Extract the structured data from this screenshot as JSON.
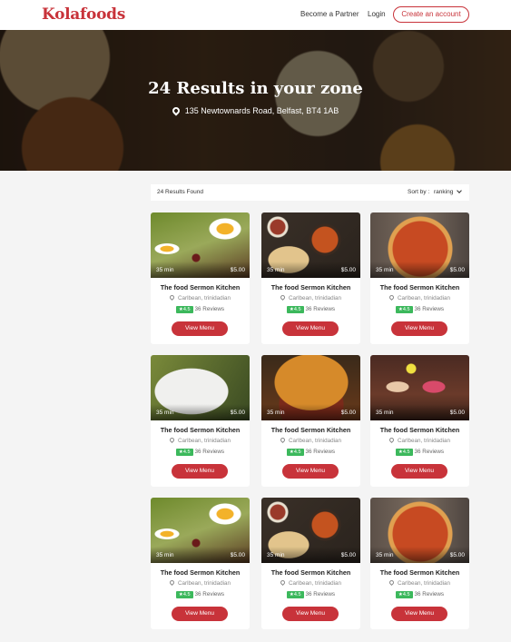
{
  "header": {
    "logo": "Kolafoods",
    "nav": {
      "partner": "Become a Partner",
      "login": "Login"
    },
    "cta": "Create an account"
  },
  "hero": {
    "title": "24 Results in your zone",
    "address": "135 Newtownards Road, Belfast, BT4 1AB"
  },
  "results": {
    "count": "24 Results Found",
    "sort_label": "Sort by :",
    "sort_value": "ranking"
  },
  "cards": [
    {
      "time": "35 min",
      "price": "$5.00",
      "name": "The food Sermon Kitchen",
      "location": "Carlbean, trinidadian",
      "rating": "4.5",
      "reviews": "36 Reviews",
      "button": "View Menu"
    },
    {
      "time": "35 min",
      "price": "$5.00",
      "name": "The food Sermon Kitchen",
      "location": "Carlbean, trinidadian",
      "rating": "4.5",
      "reviews": "36 Reviews",
      "button": "View Menu"
    },
    {
      "time": "35 min",
      "price": "$5.00",
      "name": "The food Sermon Kitchen",
      "location": "Carlbean, trinidadian",
      "rating": "4.5",
      "reviews": "36 Reviews",
      "button": "View Menu"
    },
    {
      "time": "35 min",
      "price": "$5.00",
      "name": "The food Sermon Kitchen",
      "location": "Carlbean, trinidadian",
      "rating": "4.5",
      "reviews": "36 Reviews",
      "button": "View Menu"
    },
    {
      "time": "35 min",
      "price": "$5.00",
      "name": "The food Sermon Kitchen",
      "location": "Carlbean, trinidadian",
      "rating": "4.5",
      "reviews": "36 Reviews",
      "button": "View Menu"
    },
    {
      "time": "35 min",
      "price": "$5.00",
      "name": "The food Sermon Kitchen",
      "location": "Carlbean, trinidadian",
      "rating": "4.5",
      "reviews": "36 Reviews",
      "button": "View Menu"
    },
    {
      "time": "35 min",
      "price": "$5.00",
      "name": "The food Sermon Kitchen",
      "location": "Carlbean, trinidadian",
      "rating": "4.5",
      "reviews": "36 Reviews",
      "button": "View Menu"
    },
    {
      "time": "35 min",
      "price": "$5.00",
      "name": "The food Sermon Kitchen",
      "location": "Carlbean, trinidadian",
      "rating": "4.5",
      "reviews": "36 Reviews",
      "button": "View Menu"
    },
    {
      "time": "35 min",
      "price": "$5.00",
      "name": "The food Sermon Kitchen",
      "location": "Carlbean, trinidadian",
      "rating": "4.5",
      "reviews": "36 Reviews",
      "button": "View Menu"
    }
  ],
  "colors": {
    "brand": "#c8333a",
    "rating": "#3cb85c"
  },
  "icons": {
    "location": "map-pin-icon",
    "star": "star-icon",
    "sort": "chevron-down-icon"
  }
}
